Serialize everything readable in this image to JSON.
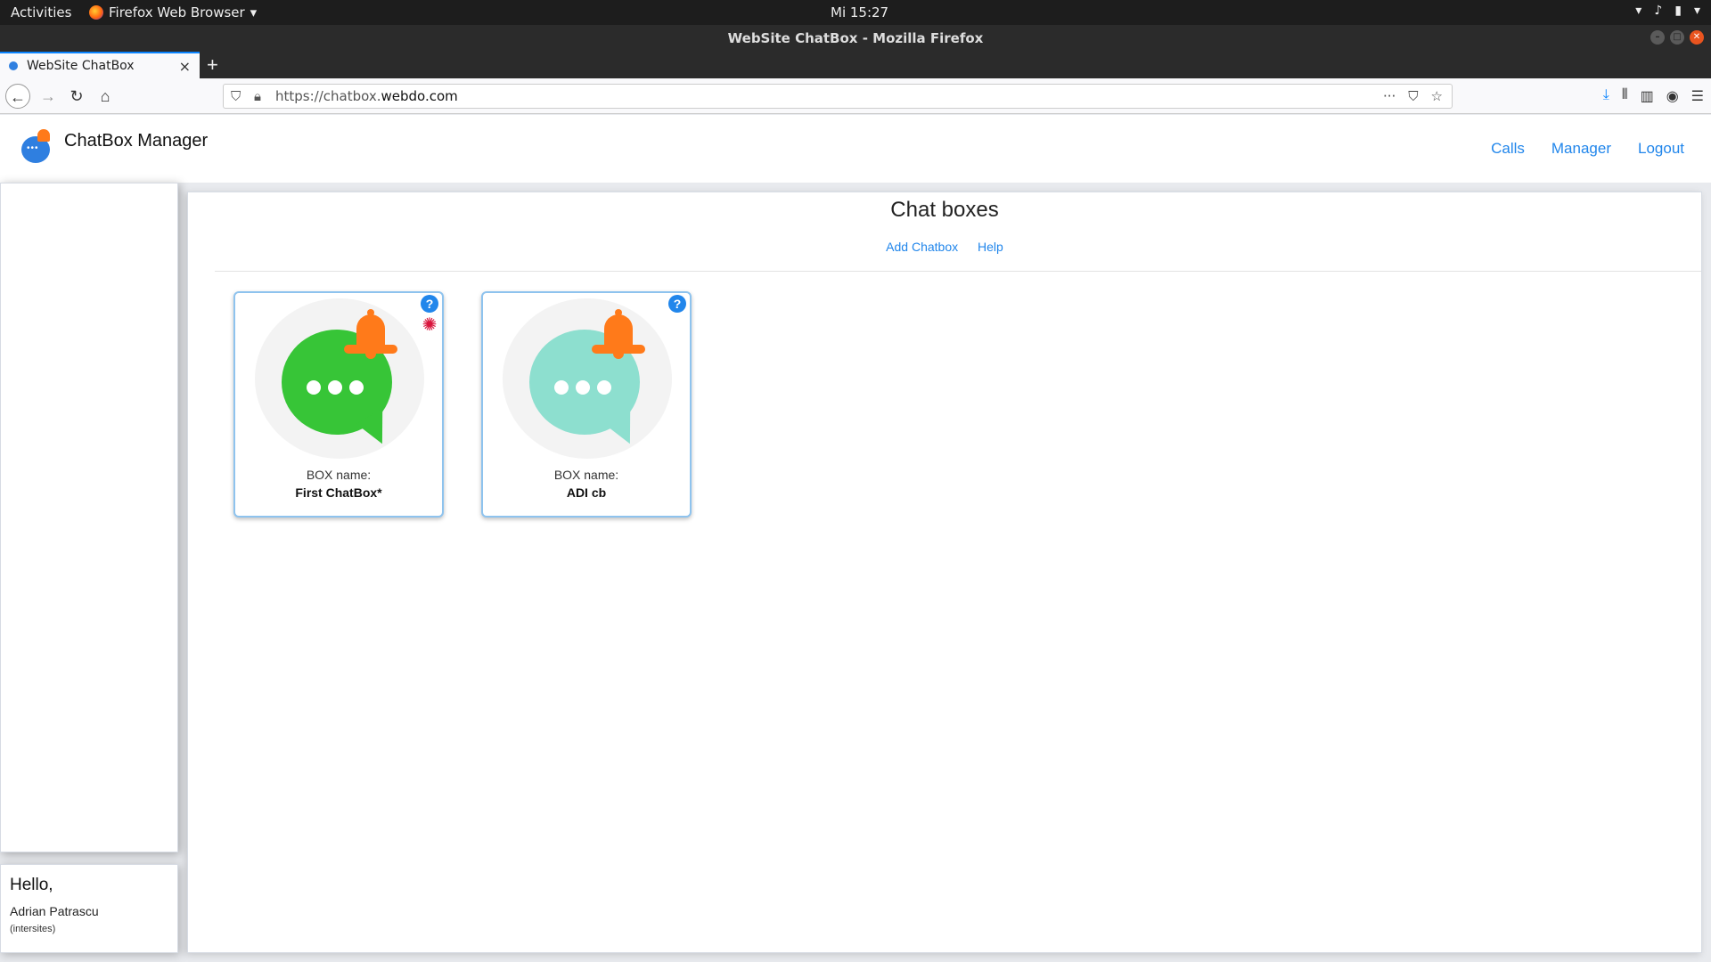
{
  "system_bar": {
    "activities": "Activities",
    "app_menu": "Firefox Web Browser",
    "clock": "Mi 15:27"
  },
  "window": {
    "title": "WebSite ChatBox - Mozilla Firefox"
  },
  "browser": {
    "tab_title": "WebSite ChatBox",
    "url_prefix": "https://chatbox.",
    "url_host": "webdo.com"
  },
  "app": {
    "title": "ChatBox Manager",
    "nav": [
      "Calls",
      "Manager",
      "Logout"
    ]
  },
  "main": {
    "heading": "Chat boxes",
    "links": [
      "Add Chatbox",
      "Help"
    ],
    "boxes": [
      {
        "label": "BOX name:",
        "name": "First ChatBox*",
        "bubble_color": "#37c537",
        "has_settings": true
      },
      {
        "label": "BOX name:",
        "name": "ADI cb",
        "bubble_color": "#8ddfcf",
        "has_settings": false
      }
    ]
  },
  "user_card": {
    "greeting": "Hello,",
    "name": "Adrian Patrascu",
    "org": "(intersites)"
  },
  "colors": {
    "link": "#2186eb",
    "bell": "#ff7a1a",
    "settings": "#d9163d"
  }
}
